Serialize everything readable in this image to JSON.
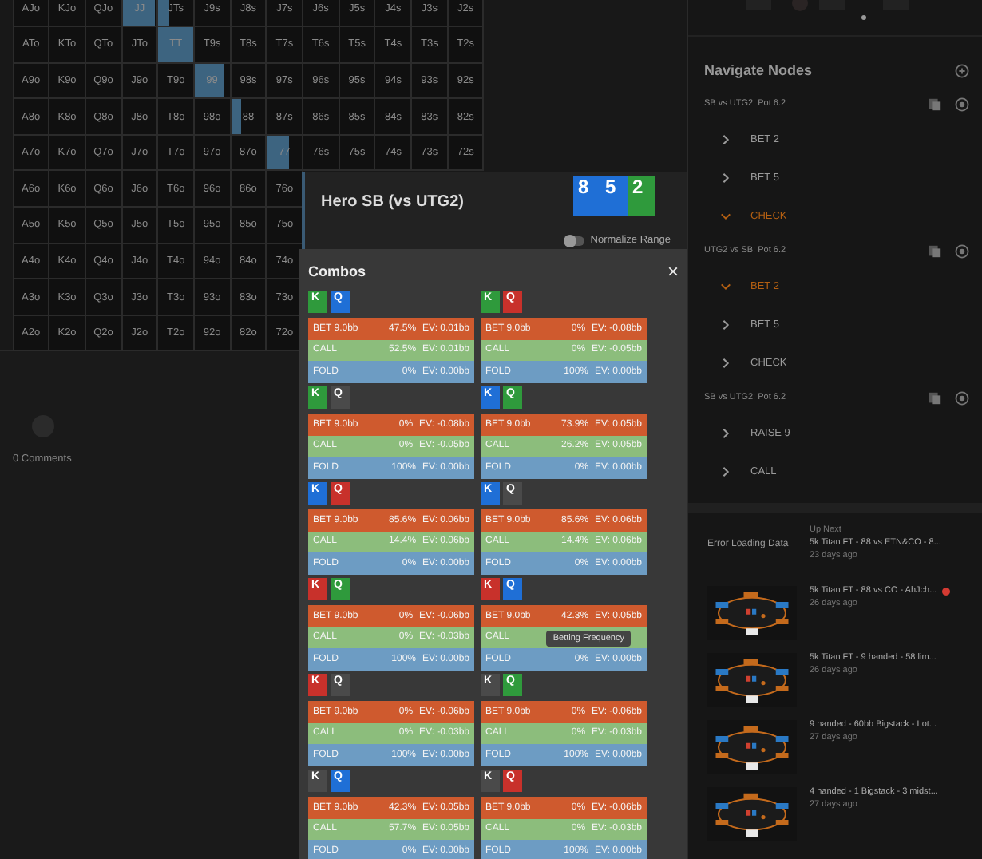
{
  "range_grid": {
    "rows": [
      [
        {
          "label": "AJo"
        },
        {
          "label": "KJo"
        },
        {
          "label": "QJo"
        },
        {
          "label": "JJ",
          "level": 0.95
        },
        {
          "label": "JTs",
          "level": 0.3
        },
        {
          "label": "J9s"
        },
        {
          "label": "J8s"
        },
        {
          "label": "J7s"
        },
        {
          "label": "J6s"
        },
        {
          "label": "J5s"
        },
        {
          "label": "J4s"
        },
        {
          "label": "J3s"
        },
        {
          "label": "J2s"
        }
      ],
      [
        {
          "label": "ATo"
        },
        {
          "label": "KTo"
        },
        {
          "label": "QTo"
        },
        {
          "label": "JTo"
        },
        {
          "label": "TT",
          "level": 1
        },
        {
          "label": "T9s"
        },
        {
          "label": "T8s"
        },
        {
          "label": "T7s"
        },
        {
          "label": "T6s"
        },
        {
          "label": "T5s"
        },
        {
          "label": "T4s"
        },
        {
          "label": "T3s"
        },
        {
          "label": "T2s"
        }
      ],
      [
        {
          "label": "A9o"
        },
        {
          "label": "K9o"
        },
        {
          "label": "Q9o"
        },
        {
          "label": "J9o"
        },
        {
          "label": "T9o"
        },
        {
          "label": "99",
          "level": 0.85
        },
        {
          "label": "98s"
        },
        {
          "label": "97s"
        },
        {
          "label": "96s"
        },
        {
          "label": "95s"
        },
        {
          "label": "94s"
        },
        {
          "label": "93s"
        },
        {
          "label": "92s"
        }
      ],
      [
        {
          "label": "A8o"
        },
        {
          "label": "K8o"
        },
        {
          "label": "Q8o"
        },
        {
          "label": "J8o"
        },
        {
          "label": "T8o"
        },
        {
          "label": "98o"
        },
        {
          "label": "88",
          "level": 0.3
        },
        {
          "label": "87s"
        },
        {
          "label": "86s"
        },
        {
          "label": "85s"
        },
        {
          "label": "84s"
        },
        {
          "label": "83s"
        },
        {
          "label": "82s"
        }
      ],
      [
        {
          "label": "A7o"
        },
        {
          "label": "K7o"
        },
        {
          "label": "Q7o"
        },
        {
          "label": "J7o"
        },
        {
          "label": "T7o"
        },
        {
          "label": "97o"
        },
        {
          "label": "87o"
        },
        {
          "label": "77",
          "level": 0.63
        },
        {
          "label": "76s"
        },
        {
          "label": "75s"
        },
        {
          "label": "74s"
        },
        {
          "label": "73s"
        },
        {
          "label": "72s"
        }
      ],
      [
        {
          "label": "A6o"
        },
        {
          "label": "K6o"
        },
        {
          "label": "Q6o"
        },
        {
          "label": "J6o"
        },
        {
          "label": "T6o"
        },
        {
          "label": "96o"
        },
        {
          "label": "86o"
        },
        {
          "label": "76o"
        }
      ],
      [
        {
          "label": "A5o"
        },
        {
          "label": "K5o"
        },
        {
          "label": "Q5o"
        },
        {
          "label": "J5o"
        },
        {
          "label": "T5o"
        },
        {
          "label": "95o"
        },
        {
          "label": "85o"
        },
        {
          "label": "75o"
        }
      ],
      [
        {
          "label": "A4o"
        },
        {
          "label": "K4o"
        },
        {
          "label": "Q4o"
        },
        {
          "label": "J4o"
        },
        {
          "label": "T4o"
        },
        {
          "label": "94o"
        },
        {
          "label": "84o"
        },
        {
          "label": "74o"
        }
      ],
      [
        {
          "label": "A3o"
        },
        {
          "label": "K3o"
        },
        {
          "label": "Q3o"
        },
        {
          "label": "J3o"
        },
        {
          "label": "T3o"
        },
        {
          "label": "93o"
        },
        {
          "label": "83o"
        },
        {
          "label": "73o"
        }
      ],
      [
        {
          "label": "A2o"
        },
        {
          "label": "K2o"
        },
        {
          "label": "Q2o"
        },
        {
          "label": "J2o"
        },
        {
          "label": "T2o"
        },
        {
          "label": "92o"
        },
        {
          "label": "82o"
        },
        {
          "label": "72o"
        }
      ]
    ]
  },
  "comments": {
    "count": "0 Comments"
  },
  "hero": {
    "title": "Hero SB (vs UTG2)",
    "chips": [
      {
        "label": "8",
        "color": "#1f6fd6"
      },
      {
        "label": "5",
        "color": "#1f6fd6"
      },
      {
        "label": "2",
        "color": "#2f9a3c"
      }
    ],
    "normalize": {
      "label": "Normalize Range",
      "on": false
    }
  },
  "combos": {
    "title": "Combos",
    "close": "×",
    "items": [
      {
        "cards": [
          {
            "rank": "K",
            "color": "#2f9a3c"
          },
          {
            "rank": "Q",
            "color": "#1f6fd6"
          }
        ],
        "actions": [
          {
            "kind": "bet",
            "label": "BET 9.0bb",
            "pct": "47.5%",
            "ev": "EV: 0.01bb"
          },
          {
            "kind": "call",
            "label": "CALL",
            "pct": "52.5%",
            "ev": "EV: 0.01bb"
          },
          {
            "kind": "fold",
            "label": "FOLD",
            "pct": "0%",
            "ev": "EV: 0.00bb"
          }
        ]
      },
      {
        "cards": [
          {
            "rank": "K",
            "color": "#2f9a3c"
          },
          {
            "rank": "Q",
            "color": "#c8312b"
          }
        ],
        "actions": [
          {
            "kind": "bet",
            "label": "BET 9.0bb",
            "pct": "0%",
            "ev": "EV: -0.08bb"
          },
          {
            "kind": "call",
            "label": "CALL",
            "pct": "0%",
            "ev": "EV: -0.05bb"
          },
          {
            "kind": "fold",
            "label": "FOLD",
            "pct": "100%",
            "ev": "EV: 0.00bb"
          }
        ]
      },
      {
        "cards": [
          {
            "rank": "K",
            "color": "#2f9a3c"
          },
          {
            "rank": "Q",
            "color": "#4a4a4a"
          }
        ],
        "actions": [
          {
            "kind": "bet",
            "label": "BET 9.0bb",
            "pct": "0%",
            "ev": "EV: -0.08bb"
          },
          {
            "kind": "call",
            "label": "CALL",
            "pct": "0%",
            "ev": "EV: -0.05bb"
          },
          {
            "kind": "fold",
            "label": "FOLD",
            "pct": "100%",
            "ev": "EV: 0.00bb"
          }
        ]
      },
      {
        "cards": [
          {
            "rank": "K",
            "color": "#1f6fd6"
          },
          {
            "rank": "Q",
            "color": "#2f9a3c"
          }
        ],
        "actions": [
          {
            "kind": "bet",
            "label": "BET 9.0bb",
            "pct": "73.9%",
            "ev": "EV: 0.05bb"
          },
          {
            "kind": "call",
            "label": "CALL",
            "pct": "26.2%",
            "ev": "EV: 0.05bb"
          },
          {
            "kind": "fold",
            "label": "FOLD",
            "pct": "0%",
            "ev": "EV: 0.00bb"
          }
        ]
      },
      {
        "cards": [
          {
            "rank": "K",
            "color": "#1f6fd6"
          },
          {
            "rank": "Q",
            "color": "#c8312b"
          }
        ],
        "actions": [
          {
            "kind": "bet",
            "label": "BET 9.0bb",
            "pct": "85.6%",
            "ev": "EV: 0.06bb"
          },
          {
            "kind": "call",
            "label": "CALL",
            "pct": "14.4%",
            "ev": "EV: 0.06bb"
          },
          {
            "kind": "fold",
            "label": "FOLD",
            "pct": "0%",
            "ev": "EV: 0.00bb"
          }
        ]
      },
      {
        "cards": [
          {
            "rank": "K",
            "color": "#1f6fd6"
          },
          {
            "rank": "Q",
            "color": "#4a4a4a"
          }
        ],
        "actions": [
          {
            "kind": "bet",
            "label": "BET 9.0bb",
            "pct": "85.6%",
            "ev": "EV: 0.06bb"
          },
          {
            "kind": "call",
            "label": "CALL",
            "pct": "14.4%",
            "ev": "EV: 0.06bb"
          },
          {
            "kind": "fold",
            "label": "FOLD",
            "pct": "0%",
            "ev": "EV: 0.00bb"
          }
        ]
      },
      {
        "cards": [
          {
            "rank": "K",
            "color": "#c8312b"
          },
          {
            "rank": "Q",
            "color": "#2f9a3c"
          }
        ],
        "actions": [
          {
            "kind": "bet",
            "label": "BET 9.0bb",
            "pct": "0%",
            "ev": "EV: -0.06bb"
          },
          {
            "kind": "call",
            "label": "CALL",
            "pct": "0%",
            "ev": "EV: -0.03bb"
          },
          {
            "kind": "fold",
            "label": "FOLD",
            "pct": "100%",
            "ev": "EV: 0.00bb"
          }
        ]
      },
      {
        "cards": [
          {
            "rank": "K",
            "color": "#c8312b"
          },
          {
            "rank": "Q",
            "color": "#1f6fd6"
          }
        ],
        "tooltip": "Betting Frequency",
        "actions": [
          {
            "kind": "bet",
            "label": "BET 9.0bb",
            "pct": "42.3%",
            "ev": "EV: 0.05bb"
          },
          {
            "kind": "call",
            "label": "CALL"
          },
          {
            "kind": "fold",
            "label": "FOLD",
            "pct": "0%",
            "ev": "EV: 0.00bb"
          }
        ]
      },
      {
        "cards": [
          {
            "rank": "K",
            "color": "#c8312b"
          },
          {
            "rank": "Q",
            "color": "#4a4a4a"
          }
        ],
        "actions": [
          {
            "kind": "bet",
            "label": "BET 9.0bb",
            "pct": "0%",
            "ev": "EV: -0.06bb"
          },
          {
            "kind": "call",
            "label": "CALL",
            "pct": "0%",
            "ev": "EV: -0.03bb"
          },
          {
            "kind": "fold",
            "label": "FOLD",
            "pct": "100%",
            "ev": "EV: 0.00bb"
          }
        ]
      },
      {
        "cards": [
          {
            "rank": "K",
            "color": "#4a4a4a"
          },
          {
            "rank": "Q",
            "color": "#2f9a3c"
          }
        ],
        "actions": [
          {
            "kind": "bet",
            "label": "BET 9.0bb",
            "pct": "0%",
            "ev": "EV: -0.06bb"
          },
          {
            "kind": "call",
            "label": "CALL",
            "pct": "0%",
            "ev": "EV: -0.03bb"
          },
          {
            "kind": "fold",
            "label": "FOLD",
            "pct": "100%",
            "ev": "EV: 0.00bb"
          }
        ]
      },
      {
        "cards": [
          {
            "rank": "K",
            "color": "#4a4a4a"
          },
          {
            "rank": "Q",
            "color": "#1f6fd6"
          }
        ],
        "actions": [
          {
            "kind": "bet",
            "label": "BET 9.0bb",
            "pct": "42.3%",
            "ev": "EV: 0.05bb"
          },
          {
            "kind": "call",
            "label": "CALL",
            "pct": "57.7%",
            "ev": "EV: 0.05bb"
          },
          {
            "kind": "fold",
            "label": "FOLD",
            "pct": "0%",
            "ev": "EV: 0.00bb"
          }
        ]
      },
      {
        "cards": [
          {
            "rank": "K",
            "color": "#4a4a4a"
          },
          {
            "rank": "Q",
            "color": "#c8312b"
          }
        ],
        "actions": [
          {
            "kind": "bet",
            "label": "BET 9.0bb",
            "pct": "0%",
            "ev": "EV: -0.06bb"
          },
          {
            "kind": "call",
            "label": "CALL",
            "pct": "0%",
            "ev": "EV: -0.03bb"
          },
          {
            "kind": "fold",
            "label": "FOLD",
            "pct": "100%",
            "ev": "EV: 0.00bb"
          }
        ]
      }
    ]
  },
  "navigate": {
    "title": "Navigate Nodes",
    "groups": [
      {
        "label": "SB vs UTG2: Pot 6.2",
        "items": [
          {
            "label": "BET 2",
            "expanded": false
          },
          {
            "label": "BET 5",
            "expanded": false
          },
          {
            "label": "CHECK",
            "expanded": true
          }
        ]
      },
      {
        "label": "UTG2 vs SB: Pot 6.2",
        "items": [
          {
            "label": "BET 2",
            "expanded": true
          },
          {
            "label": "BET 5",
            "expanded": false
          },
          {
            "label": "CHECK",
            "expanded": false
          }
        ]
      },
      {
        "label": "SB vs UTG2: Pot 6.2",
        "items": [
          {
            "label": "RAISE 9",
            "expanded": false
          },
          {
            "label": "CALL",
            "expanded": false
          }
        ]
      }
    ]
  },
  "up_next": {
    "error": "Error Loading Data",
    "label": "Up Next",
    "items": [
      {
        "title": "5k Titan FT - 88 vs ETN&CO - 8...",
        "age": "23 days ago",
        "thumbnail": false,
        "alert": false
      },
      {
        "title": "5k Titan FT - 88 vs CO - AhJch...",
        "age": "26 days ago",
        "thumbnail": true,
        "alert": true
      },
      {
        "title": "5k Titan FT - 9 handed - 58 lim...",
        "age": "26 days ago",
        "thumbnail": true,
        "alert": false
      },
      {
        "title": "9 handed - 60bb Bigstack - Lot...",
        "age": "27 days ago",
        "thumbnail": true,
        "alert": false
      },
      {
        "title": "4 handed - 1 Bigstack - 3 midst...",
        "age": "27 days ago",
        "thumbnail": true,
        "alert": false
      }
    ]
  }
}
